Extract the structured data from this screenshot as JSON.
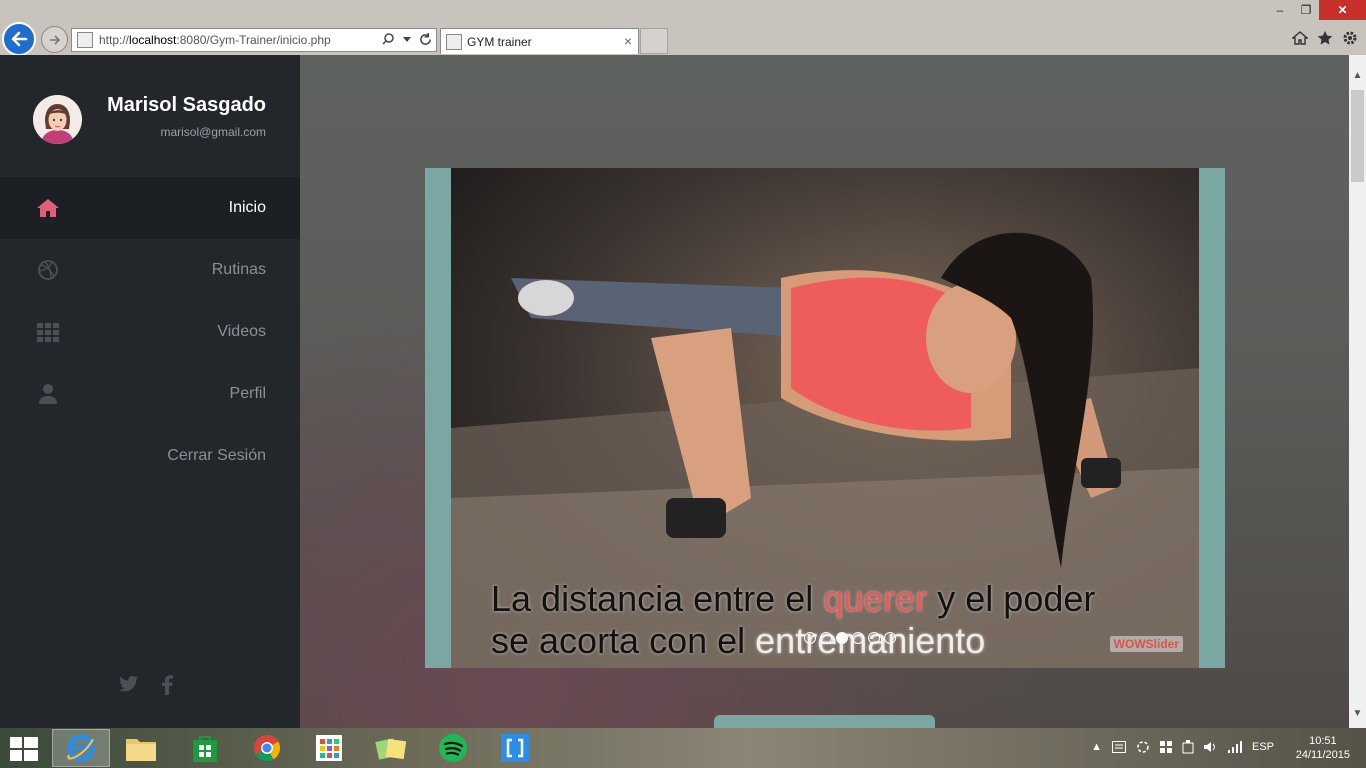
{
  "browser": {
    "url_prefix": "http://",
    "url_host": "localhost",
    "url_rest": ":8080/Gym-Trainer/inicio.php",
    "tab_title": "GYM trainer",
    "tab_close": "×"
  },
  "window_controls": {
    "minimize": "‒",
    "restore": "❐",
    "close": "✕"
  },
  "sidebar": {
    "user_name": "Marisol Sasgado",
    "user_email": "marisol@gmail.com",
    "items": [
      {
        "label": "Inicio",
        "icon": "home-icon"
      },
      {
        "label": "Rutinas",
        "icon": "dribbble-icon"
      },
      {
        "label": "Videos",
        "icon": "grid-icon"
      },
      {
        "label": "Perfil",
        "icon": "user-icon"
      },
      {
        "label": "Cerrar Sesión",
        "icon": ""
      }
    ]
  },
  "slider": {
    "line1_a": "La distancia entre el ",
    "line1_accent": "querer",
    "line1_b": " y el poder",
    "line2_a": "se acorta con el ",
    "line2_b": "entremaniento",
    "watermark": "WOWSlider",
    "active_slide": 3,
    "slide_count": 6
  },
  "taskbar": {
    "language": "ESP",
    "time": "10:51",
    "date": "24/11/2015"
  },
  "colors": {
    "sidebar_bg": "#23272c",
    "accent": "#e0607a",
    "slider_frame": "#7aa7a3",
    "close_button": "#c7302a"
  }
}
